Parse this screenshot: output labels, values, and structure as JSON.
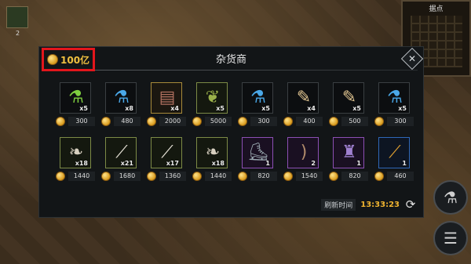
{
  "hud": {
    "slot_count": "2",
    "minimap_title": "据点"
  },
  "shop": {
    "gold": "100亿",
    "title": "杂货商",
    "refresh_label": "刷新时间",
    "refresh_time": "13:33:23",
    "items": [
      {
        "icon": "green-potion-icon",
        "glyph": "⚗",
        "color": "#7fd040",
        "qty": "x5",
        "price": "300",
        "rarity": "r-none"
      },
      {
        "icon": "blue-potion-icon",
        "glyph": "⚗",
        "color": "#4aa8e8",
        "qty": "x8",
        "price": "480",
        "rarity": "r-none"
      },
      {
        "icon": "book-icon",
        "glyph": "▤",
        "color": "#b07060",
        "qty": "x4",
        "price": "2000",
        "rarity": "r-gold"
      },
      {
        "icon": "herb-bag-icon",
        "glyph": "❦",
        "color": "#9ab04a",
        "qty": "x5",
        "price": "5000",
        "rarity": "r-green"
      },
      {
        "icon": "blue-potion-icon",
        "glyph": "⚗",
        "color": "#4aa8e8",
        "qty": "x5",
        "price": "300",
        "rarity": "r-none"
      },
      {
        "icon": "scroll-icon",
        "glyph": "✎",
        "color": "#e0c490",
        "qty": "x4",
        "price": "400",
        "rarity": "r-none"
      },
      {
        "icon": "scroll-icon",
        "glyph": "✎",
        "color": "#e0c490",
        "qty": "x5",
        "price": "500",
        "rarity": "r-none"
      },
      {
        "icon": "blue-potion-icon",
        "glyph": "⚗",
        "color": "#4aa8e8",
        "qty": "x5",
        "price": "300",
        "rarity": "r-none"
      },
      {
        "icon": "feather-icon",
        "glyph": "❧",
        "color": "#d8d0c0",
        "qty": "x18",
        "price": "1440",
        "rarity": "r-green"
      },
      {
        "icon": "bone-icon",
        "glyph": "⟋",
        "color": "#e8e4d8",
        "qty": "x21",
        "price": "1680",
        "rarity": "r-green"
      },
      {
        "icon": "bone-icon",
        "glyph": "⟋",
        "color": "#e8e4d8",
        "qty": "x17",
        "price": "1360",
        "rarity": "r-green"
      },
      {
        "icon": "feather-icon",
        "glyph": "❧",
        "color": "#d8d0c0",
        "qty": "x18",
        "price": "1440",
        "rarity": "r-green"
      },
      {
        "icon": "boots-icon",
        "glyph": "⛸",
        "color": "#9aa8b0",
        "qty": "1",
        "price": "820",
        "rarity": "r-purple"
      },
      {
        "icon": "bow-icon",
        "glyph": ")",
        "color": "#b08a6a",
        "qty": "2",
        "price": "1540",
        "rarity": "r-purple"
      },
      {
        "icon": "robe-icon",
        "glyph": "♜",
        "color": "#a080d0",
        "qty": "1",
        "price": "820",
        "rarity": "r-purple"
      },
      {
        "icon": "staff-icon",
        "glyph": "⟋",
        "color": "#e0a030",
        "qty": "1",
        "price": "460",
        "rarity": "r-blue"
      }
    ]
  }
}
